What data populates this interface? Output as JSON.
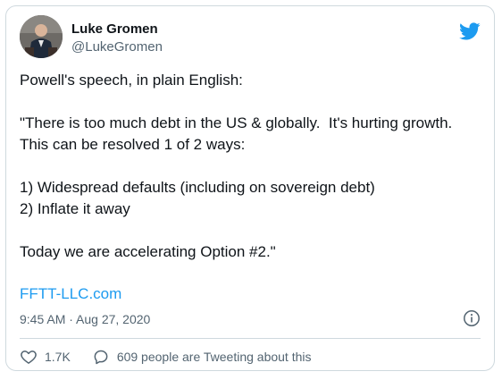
{
  "author": {
    "name": "Luke Gromen",
    "handle": "@LukeGromen"
  },
  "tweet": {
    "lines": [
      "Powell's speech, in plain English:",
      "",
      "\"There is too much debt in the US & globally.  It's hurting growth.  This can be resolved 1 of 2 ways:",
      "",
      "1) Widespread defaults (including on sovereign debt)",
      "2) Inflate it away",
      "",
      "Today we are accelerating Option #2.\""
    ],
    "link": "FFTT-LLC.com",
    "timestamp": "9:45 AM · Aug 27, 2020"
  },
  "actions": {
    "likes": "1.7K",
    "conversation": "609 people are Tweeting about this"
  },
  "colors": {
    "brand": "#1d9bf0",
    "text": "#0f1419",
    "secondary": "#536471",
    "border": "#cfd9de"
  },
  "icons": {
    "logo": "twitter-bird-icon",
    "info": "info-icon",
    "like": "heart-icon",
    "reply": "speech-bubble-icon"
  }
}
